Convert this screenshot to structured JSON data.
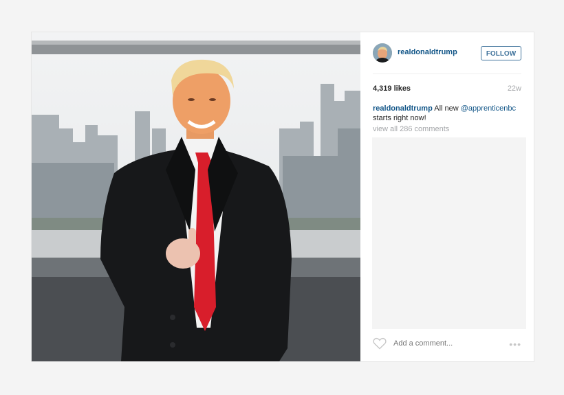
{
  "post": {
    "image_alt": "Man in dark coat and red tie giving thumbs up on a rooftop overlooking a city skyline",
    "author": {
      "username": "realdonaldtrump",
      "avatar_icon": "profile-avatar"
    },
    "follow_label": "FOLLOW",
    "likes": "4,319 likes",
    "age": "22w",
    "caption": {
      "username": "realdonaldtrump",
      "text_before": " All new ",
      "mention": "@apprenticenbc",
      "text_after": " starts right now!"
    },
    "view_all_comments": "view all 286 comments",
    "comment_placeholder": "Add a comment...",
    "icons": {
      "like": "heart-icon",
      "more": "more-options-icon"
    },
    "colors": {
      "link": "#125688",
      "follow_border": "#3f729b",
      "muted": "#a5a7aa"
    }
  }
}
